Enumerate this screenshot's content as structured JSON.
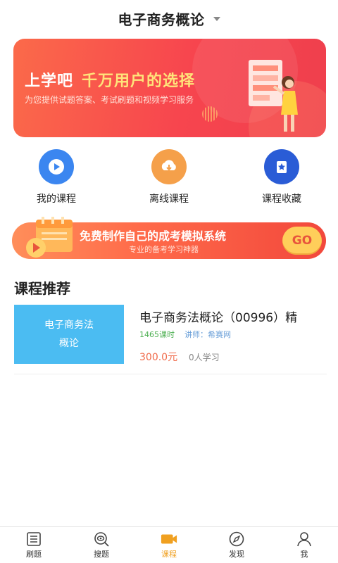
{
  "header": {
    "title": "电子商务概论"
  },
  "banner": {
    "title_main": "上学吧",
    "title_highlight": "千万用户的选择",
    "subtitle": "为您提供试题答案、考试刷题和视频学习服务"
  },
  "quick_entries": [
    {
      "label": "我的课程",
      "icon": "play-icon",
      "color": "#3b86f0"
    },
    {
      "label": "离线课程",
      "icon": "cloud-download-icon",
      "color": "#f5a04a"
    },
    {
      "label": "课程收藏",
      "icon": "bookmark-star-icon",
      "color": "#2a5cd6"
    }
  ],
  "promo": {
    "title": "免费制作自己的成考模拟系统",
    "subtitle": "专业的备考学习神器",
    "go_label": "GO"
  },
  "recommend": {
    "title": "课程推荐",
    "courses": [
      {
        "thumb_line1": "电子商务法",
        "thumb_line2": "概论",
        "name": "电子商务法概论（00996）精",
        "hours": "1465课时",
        "lecturer": "讲师：希赛网",
        "price": "300.0元",
        "learners": "0人学习"
      }
    ]
  },
  "tabbar": {
    "active": "课程",
    "tabs": [
      {
        "label": "刷题",
        "icon": "list-icon"
      },
      {
        "label": "搜题",
        "icon": "search-eye-icon"
      },
      {
        "label": "课程",
        "icon": "video-camera-icon"
      },
      {
        "label": "发现",
        "icon": "compass-icon"
      },
      {
        "label": "我",
        "icon": "user-icon"
      }
    ]
  },
  "colors": {
    "accent": "#f0a020",
    "banner": "#f7454e",
    "course_thumb": "#4bbcf2",
    "price": "#f06a4a"
  }
}
